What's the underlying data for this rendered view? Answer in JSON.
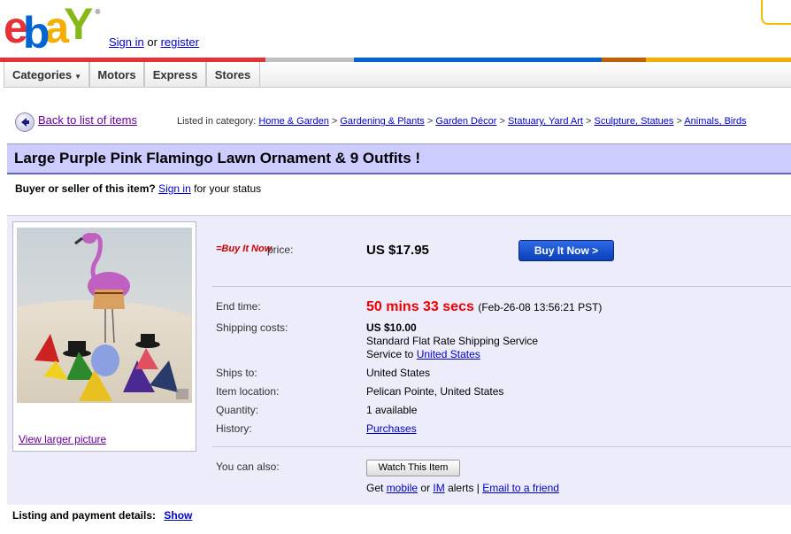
{
  "header": {
    "logo_letters": [
      "e",
      "b",
      "a",
      "Y"
    ],
    "logo_colors": [
      "#e53238",
      "#0064d2",
      "#f5af02",
      "#86b817"
    ],
    "signin_link": "Sign in",
    "or_text": "or",
    "register_link": "register"
  },
  "colorbar": [
    "#e53238",
    "#0064d2",
    "#f5af02",
    "#86b817"
  ],
  "nav": {
    "tabs": [
      "Categories",
      "Motors",
      "Express",
      "Stores"
    ]
  },
  "back": {
    "label": "Back to list of items"
  },
  "breadcrumb": {
    "prefix": "Listed in category:",
    "items": [
      "Home & Garden",
      "Gardening & Plants",
      "Garden Décor",
      "Statuary, Yard Art",
      "Sculpture, Statues",
      "Animals, Birds"
    ]
  },
  "item": {
    "title": "Large Purple Pink Flamingo Lawn Ornament & 9 Outfits !",
    "buyer_prefix": "Buyer or seller of this item?",
    "buyer_link": "Sign in",
    "buyer_suffix": "for your status",
    "view_larger": "View larger picture"
  },
  "details": {
    "bin_logo": "=Buy It Now",
    "price_label": "price:",
    "price": "US $17.95",
    "buy_button": "Buy It Now >",
    "end_time_label": "End time:",
    "end_time_remaining": "50 mins 33 secs",
    "end_time_date": "(Feb-26-08 13:56:21 PST)",
    "shipping_label": "Shipping costs:",
    "shipping_cost": "US $10.00",
    "shipping_service": "Standard Flat Rate Shipping Service",
    "service_to_prefix": "Service to",
    "service_to_link": "United States",
    "ships_to_label": "Ships to:",
    "ships_to": "United States",
    "location_label": "Item location:",
    "location": "Pelican Pointe, United States",
    "quantity_label": "Quantity:",
    "quantity": "1 available",
    "history_label": "History:",
    "history_link": "Purchases",
    "can_also_label": "You can also:",
    "watch_button": "Watch This Item",
    "get_prefix": "Get",
    "mobile_link": "mobile",
    "or_text": "or",
    "im_link": "IM",
    "alerts_text": "alerts |",
    "email_link": "Email to a friend"
  },
  "listing": {
    "label": "Listing and payment details:",
    "show_link": "Show"
  }
}
